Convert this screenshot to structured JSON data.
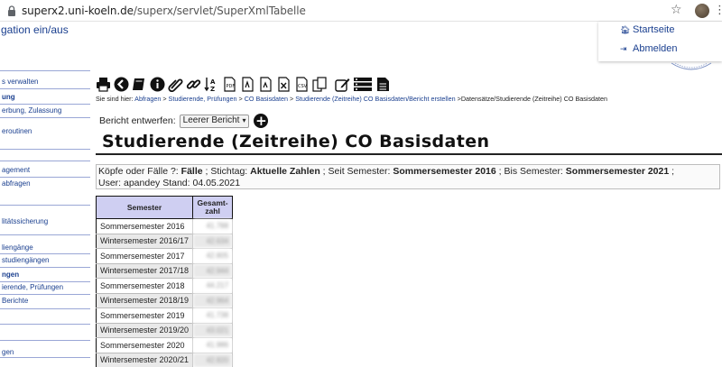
{
  "browser": {
    "url_host": "superx2.uni-koeln.de",
    "url_path": "/superx/servlet/SuperXmlTabelle"
  },
  "nav": {
    "toggle_label": "gation ein/aus",
    "items": [
      {
        "label": "s verwalten",
        "bold": false
      },
      {
        "label": "ung",
        "bold": true
      },
      {
        "label": "erbung, Zulassung",
        "bold": false
      },
      {
        "label": "eroutinen",
        "bold": false
      },
      {
        "label": "agement",
        "bold": false
      },
      {
        "label": "abfragen",
        "bold": false
      },
      {
        "label": "litätssicherung",
        "bold": false
      },
      {
        "label": "liengänge",
        "bold": false
      },
      {
        "label": "studiengängen",
        "bold": false
      },
      {
        "label": "ngen",
        "bold": true
      },
      {
        "label": "ierende, Prüfungen",
        "bold": false
      },
      {
        "label": "Berichte",
        "bold": false
      },
      {
        "label": "gen",
        "bold": false
      }
    ]
  },
  "toplinks": {
    "start_label": "Startseite",
    "logout_label": "Abmelden"
  },
  "toolbar": {
    "icons": [
      "print-icon",
      "back-icon",
      "book-icon",
      "info-icon",
      "attachment-icon",
      "link-icon",
      "sort-icon",
      "pdf-icon",
      "odt-icon",
      "ods-icon",
      "xls-icon",
      "csv-icon",
      "copy-icon",
      "edit-icon",
      "list-icon",
      "document-icon"
    ]
  },
  "breadcrumb": {
    "prefix": "Sie sind hier:",
    "links": [
      "Abfragen",
      "Studierende, Prüfungen",
      "CO Basisdaten",
      "Studierende (Zeitreihe) CO Basisdaten/Bericht erstellen"
    ],
    "current": "Datensätze/Studierende (Zeitreihe) CO Basisdaten"
  },
  "report": {
    "label": "Bericht entwerfen:",
    "selected": "Leerer Bericht"
  },
  "page_title": "Studierende (Zeitreihe) CO Basisdaten",
  "info": {
    "k1": "Köpfe oder Fälle ?:",
    "v1": "Fälle",
    "k2": "Stichtag:",
    "v2": "Aktuelle Zahlen",
    "k3": "Seit Semester:",
    "v3": "Sommersemester 2016",
    "k4": "Bis Semester:",
    "v4": "Sommersemester 2021",
    "line2": "User: apandey  Stand: 04.05.2021"
  },
  "table": {
    "headers": [
      "Semester",
      "Gesamt-",
      "zahl"
    ],
    "rows": [
      {
        "semester": "Sommersemester 2016",
        "value": "41.788"
      },
      {
        "semester": "Wintersemester 2016/17",
        "value": "42.634"
      },
      {
        "semester": "Sommersemester 2017",
        "value": "42.805"
      },
      {
        "semester": "Wintersemester 2017/18",
        "value": "42.944"
      },
      {
        "semester": "Sommersemester 2018",
        "value": "44.217"
      },
      {
        "semester": "Wintersemester 2018/19",
        "value": "42.964"
      },
      {
        "semester": "Sommersemester 2019",
        "value": "41.738"
      },
      {
        "semester": "Wintersemester 2019/20",
        "value": "43.021"
      },
      {
        "semester": "Sommersemester 2020",
        "value": "41.986"
      },
      {
        "semester": "Wintersemester 2020/21",
        "value": "42.820"
      }
    ]
  }
}
